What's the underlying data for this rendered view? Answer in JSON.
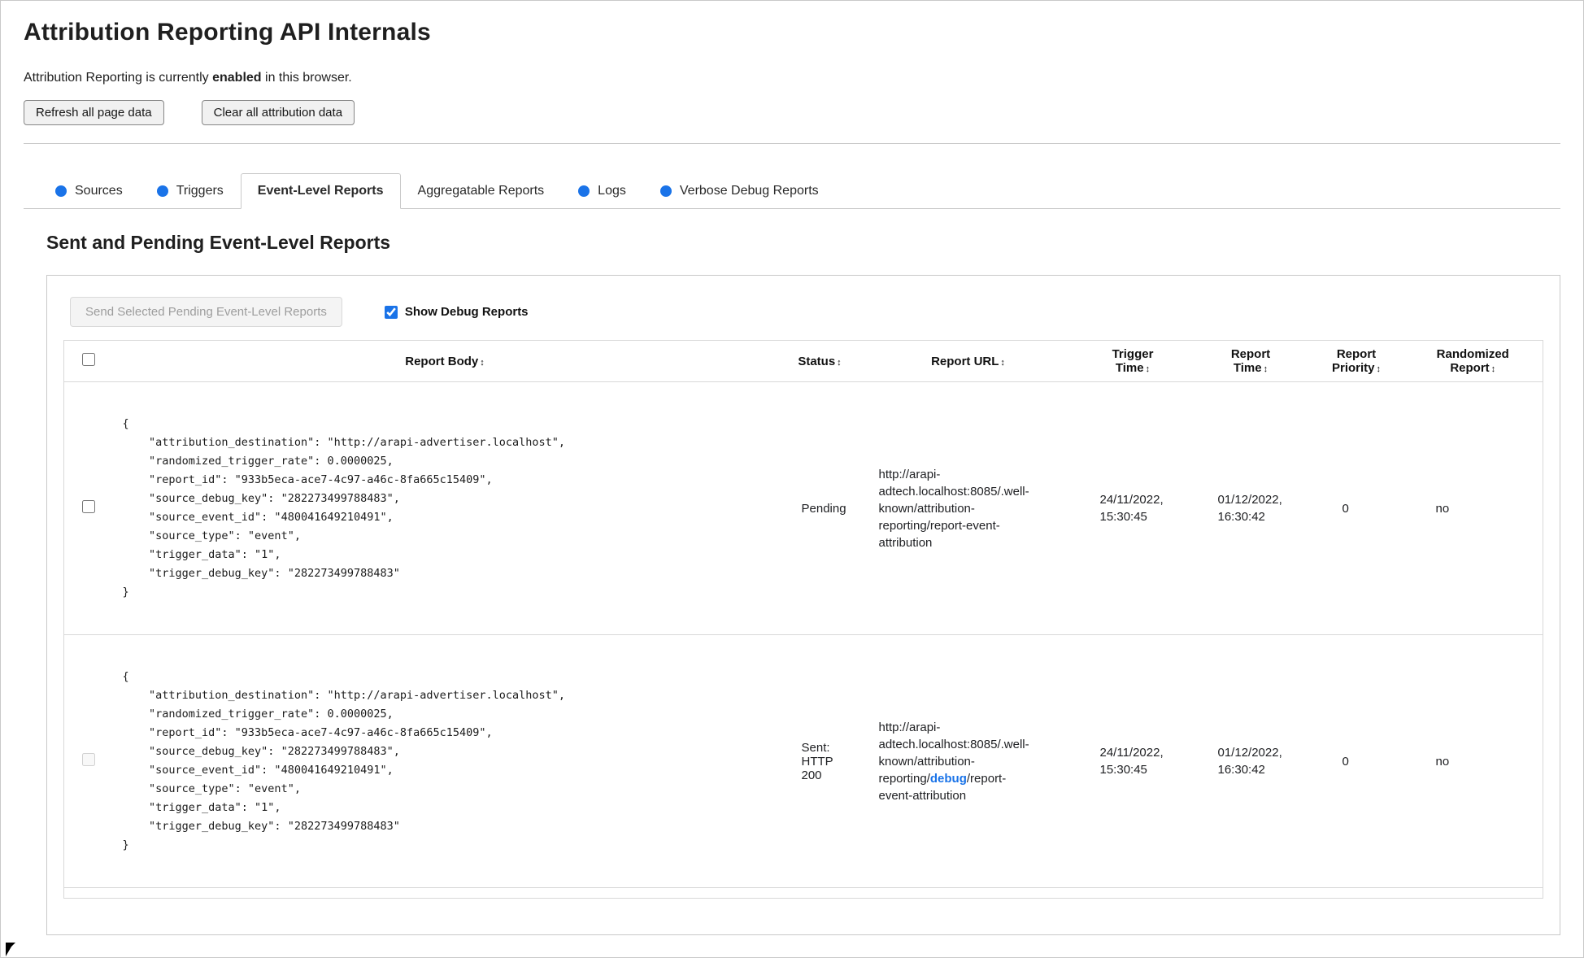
{
  "colors": {
    "accent_blue": "#1a73e8",
    "link_blue": "#1a73e8"
  },
  "page": {
    "title": "Attribution Reporting API Internals",
    "status_prefix": "Attribution Reporting is currently ",
    "status_bold": "enabled",
    "status_suffix": " in this browser.",
    "refresh_button": "Refresh all page data",
    "clear_button": "Clear all attribution data"
  },
  "tabs": [
    {
      "label": "Sources"
    },
    {
      "label": "Triggers"
    },
    {
      "label": "Event-Level Reports"
    },
    {
      "label": "Aggregatable Reports"
    },
    {
      "label": "Logs"
    },
    {
      "label": "Verbose Debug Reports"
    }
  ],
  "section": {
    "title": "Sent and Pending Event-Level Reports",
    "send_button": "Send Selected Pending Event-Level Reports",
    "show_debug_label": "Show Debug Reports"
  },
  "table": {
    "sort_icon": "↕",
    "headers": [
      "Report Body",
      "Status",
      "Report URL",
      "Trigger\nTime",
      "Report\nTime",
      "Report\nPriority",
      "Randomized\nReport"
    ],
    "rows": [
      {
        "report_body": "{\n    \"attribution_destination\": \"http://arapi-advertiser.localhost\",\n    \"randomized_trigger_rate\": 0.0000025,\n    \"report_id\": \"933b5eca-ace7-4c97-a46c-8fa665c15409\",\n    \"source_debug_key\": \"282273499788483\",\n    \"source_event_id\": \"480041649210491\",\n    \"source_type\": \"event\",\n    \"trigger_data\": \"1\",\n    \"trigger_debug_key\": \"282273499788483\"\n}",
        "status": "Pending",
        "report_url": "http://arapi-adtech.localhost:8085/.well-known/attribution-reporting/report-event-attribution",
        "trigger_time": "24/11/2022, 15:30:45",
        "report_time": "01/12/2022, 16:30:42",
        "report_priority": "0",
        "randomized_report": "no"
      },
      {
        "report_body": "{\n    \"attribution_destination\": \"http://arapi-advertiser.localhost\",\n    \"randomized_trigger_rate\": 0.0000025,\n    \"report_id\": \"933b5eca-ace7-4c97-a46c-8fa665c15409\",\n    \"source_debug_key\": \"282273499788483\",\n    \"source_event_id\": \"480041649210491\",\n    \"source_type\": \"event\",\n    \"trigger_data\": \"1\",\n    \"trigger_debug_key\": \"282273499788483\"\n}",
        "status": "Sent: HTTP 200",
        "report_url_prefix": "http://arapi-adtech.localhost:8085/.well-known/attribution-reporting/",
        "report_url_link": "debug",
        "report_url_suffix": "/report-event-attribution",
        "trigger_time": "24/11/2022, 15:30:45",
        "report_time": "01/12/2022, 16:30:42",
        "report_priority": "0",
        "randomized_report": "no"
      }
    ]
  }
}
